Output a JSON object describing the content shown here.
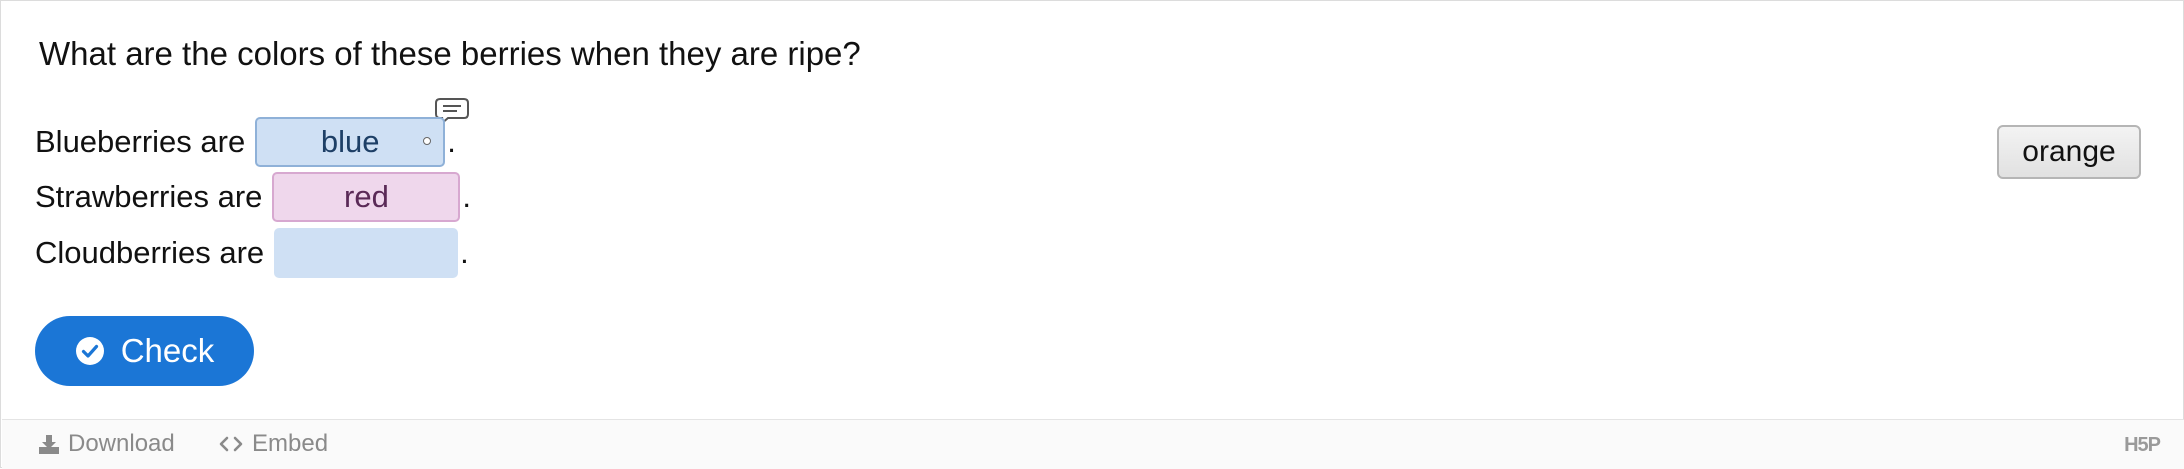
{
  "question": "What are the colors of these berries when they are ripe?",
  "sentences": [
    {
      "label": "Blueberries are",
      "answer": "blue",
      "period": "."
    },
    {
      "label": "Strawberries are",
      "answer": "red",
      "period": "."
    },
    {
      "label": "Cloudberries are",
      "answer": "",
      "period": "."
    }
  ],
  "draggables": [
    {
      "label": "orange"
    }
  ],
  "check_button": {
    "label": "Check"
  },
  "footer": {
    "download_label": "Download",
    "embed_label": "Embed",
    "logo_text": "H5P"
  },
  "colors": {
    "accent": "#1b76d6",
    "dropzone_blue": "#cfe0f4",
    "dropzone_pink": "#efd7ec"
  },
  "icons": {
    "tip": "speech-bubble-icon",
    "check": "check-circle-icon",
    "download": "download-icon",
    "embed": "code-icon"
  }
}
